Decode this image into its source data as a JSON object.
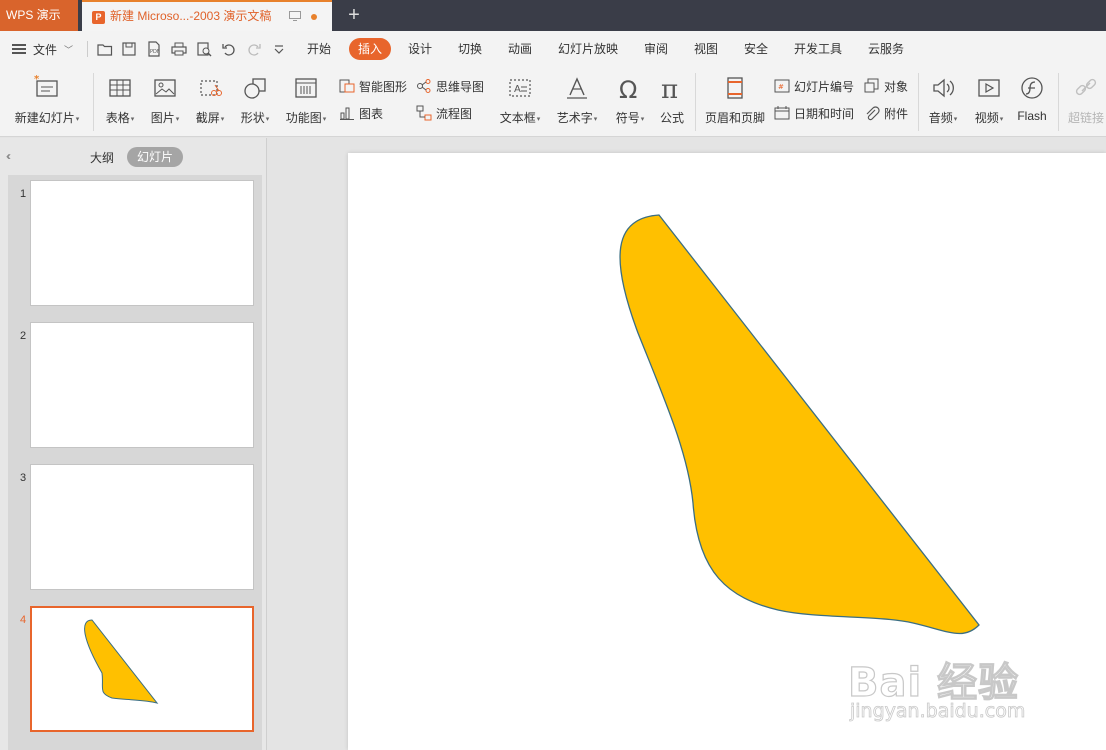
{
  "app": {
    "name": "WPS 演示"
  },
  "document_tab": {
    "title": "新建 Microso...-2003 演示文稿"
  },
  "new_tab": {
    "label": "+"
  },
  "menubar": {
    "file_label": "文件",
    "tabs": [
      {
        "label": "开始",
        "active": false
      },
      {
        "label": "插入",
        "active": true
      },
      {
        "label": "设计",
        "active": false
      },
      {
        "label": "切换",
        "active": false
      },
      {
        "label": "动画",
        "active": false
      },
      {
        "label": "幻灯片放映",
        "active": false
      },
      {
        "label": "审阅",
        "active": false
      },
      {
        "label": "视图",
        "active": false
      },
      {
        "label": "安全",
        "active": false
      },
      {
        "label": "开发工具",
        "active": false
      },
      {
        "label": "云服务",
        "active": false
      }
    ]
  },
  "ribbon": {
    "new_slide": "新建幻灯片",
    "table": "表格",
    "picture": "图片",
    "screenshot": "截屏",
    "shapes": "形状",
    "function_chart": "功能图",
    "smart_art": "智能图形",
    "chart": "图表",
    "mind_map": "思维导图",
    "flowchart": "流程图",
    "text_box": "文本框",
    "word_art": "艺术字",
    "symbol": "符号",
    "formula": "公式",
    "header_footer": "页眉和页脚",
    "slide_number": "幻灯片编号",
    "date_time": "日期和时间",
    "object": "对象",
    "attachment": "附件",
    "audio": "音频",
    "video": "视频",
    "flash": "Flash",
    "hyperlink": "超链接",
    "accent_color": "#e8652c"
  },
  "side_panel": {
    "outline_tab": "大纲",
    "slides_tab": "幻灯片",
    "slides": [
      {
        "number": "1",
        "selected": false
      },
      {
        "number": "2",
        "selected": false
      },
      {
        "number": "3",
        "selected": false
      },
      {
        "number": "4",
        "selected": true
      }
    ]
  },
  "slide": {
    "shape": {
      "type": "freeform",
      "fill": "#ffc000",
      "stroke": "#3b6e82"
    }
  },
  "watermark": {
    "main": "Bai 经验",
    "sub": "jingyan.baidu.com"
  }
}
